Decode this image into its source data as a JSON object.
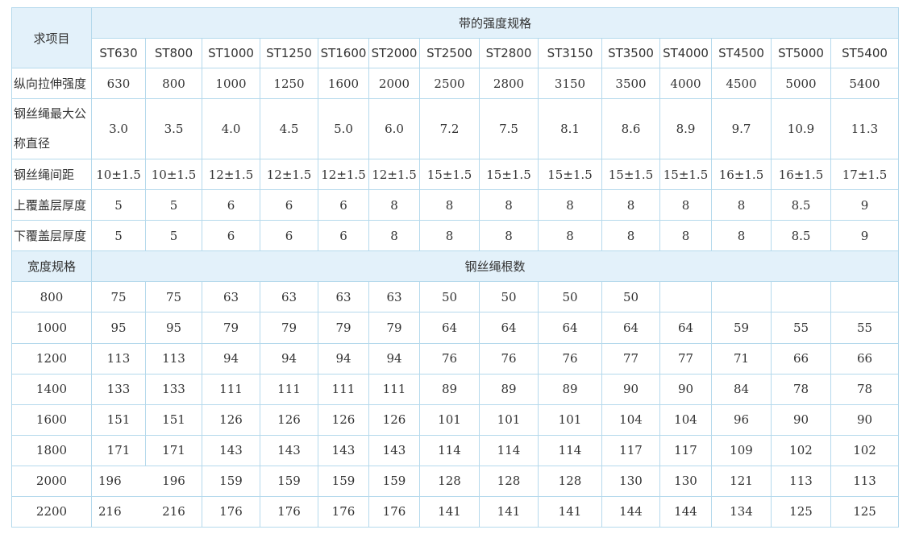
{
  "title": "带的强度规格",
  "item_header": "求项目",
  "spec_names": [
    "ST630",
    "ST800",
    "ST1000",
    "ST1250",
    "ST1600",
    "ST2000",
    "ST2500",
    "ST2800",
    "ST3150",
    "ST3500",
    "ST4000",
    "ST4500",
    "ST5000",
    "ST5400"
  ],
  "rows": [
    {
      "label": "纵向拉伸强度",
      "values": [
        "630",
        "800",
        "1000",
        "1250",
        "1600",
        "2000",
        "2500",
        "2800",
        "3150",
        "3500",
        "4000",
        "4500",
        "5000",
        "5400"
      ]
    },
    {
      "label": "钢丝绳最大公称直径",
      "values": [
        "3.0",
        "3.5",
        "4.0",
        "4.5",
        "5.0",
        "6.0",
        "7.2",
        "7.5",
        "8.1",
        "8.6",
        "8.9",
        "9.7",
        "10.9",
        "11.3"
      ]
    },
    {
      "label": "钢丝绳间距",
      "values": [
        "10±1.5",
        "10±1.5",
        "12±1.5",
        "12±1.5",
        "12±1.5",
        "12±1.5",
        "15±1.5",
        "15±1.5",
        "15±1.5",
        "15±1.5",
        "15±1.5",
        "16±1.5",
        "16±1.5",
        "17±1.5"
      ]
    },
    {
      "label": "上覆盖层厚度",
      "values": [
        "5",
        "5",
        "6",
        "6",
        "6",
        "8",
        "8",
        "8",
        "8",
        "8",
        "8",
        "8",
        "8.5",
        "9"
      ]
    },
    {
      "label": "下覆盖层厚度",
      "values": [
        "5",
        "5",
        "6",
        "6",
        "6",
        "8",
        "8",
        "8",
        "8",
        "8",
        "8",
        "8",
        "8.5",
        "9"
      ]
    }
  ],
  "width_header": "宽度规格",
  "cord_header": "钢丝绳根数",
  "width_rows": [
    {
      "width": "800",
      "values": [
        "75",
        "75",
        "63",
        "63",
        "63",
        "63",
        "50",
        "50",
        "50",
        "50",
        "",
        "",
        "",
        ""
      ]
    },
    {
      "width": "1000",
      "values": [
        "95",
        "95",
        "79",
        "79",
        "79",
        "79",
        "64",
        "64",
        "64",
        "64",
        "64",
        "59",
        "55",
        "55"
      ]
    },
    {
      "width": "1200",
      "values": [
        "113",
        "113",
        "94",
        "94",
        "94",
        "94",
        "76",
        "76",
        "76",
        "77",
        "77",
        "71",
        "66",
        "66"
      ]
    },
    {
      "width": "1400",
      "values": [
        "133",
        "133",
        "111",
        "111",
        "111",
        "111",
        "89",
        "89",
        "89",
        "90",
        "90",
        "84",
        "78",
        "78"
      ]
    },
    {
      "width": "1600",
      "values": [
        "151",
        "151",
        "126",
        "126",
        "126",
        "126",
        "101",
        "101",
        "101",
        "104",
        "104",
        "96",
        "90",
        "90"
      ]
    },
    {
      "width": "1800",
      "values": [
        "171",
        "171",
        "143",
        "143",
        "143",
        "143",
        "114",
        "114",
        "114",
        "117",
        "117",
        "109",
        "102",
        "102"
      ]
    },
    {
      "width": "2000",
      "values": [
        "196",
        "196",
        "159",
        "159",
        "159",
        "159",
        "128",
        "128",
        "128",
        "130",
        "130",
        "121",
        "113",
        "113"
      ]
    },
    {
      "width": "2200",
      "values": [
        "216",
        "216",
        "176",
        "176",
        "176",
        "176",
        "141",
        "141",
        "141",
        "144",
        "144",
        "134",
        "125",
        "125"
      ]
    }
  ]
}
